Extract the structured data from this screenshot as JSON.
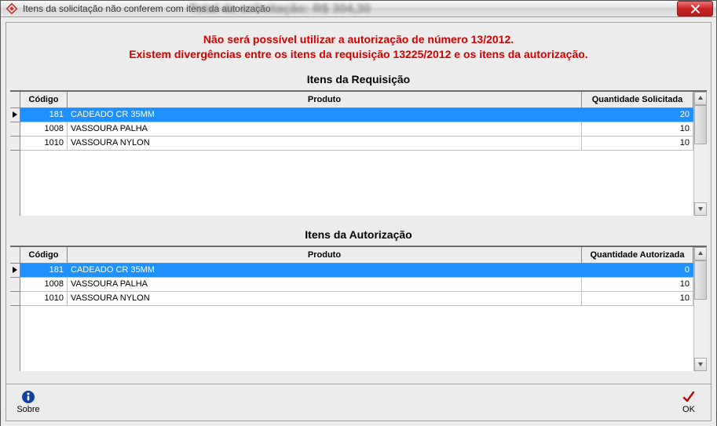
{
  "window": {
    "title": "Itens da solicitação não conferem com itens da autorização",
    "blurred_bg_text": "Total da solicitação: R$ 304,30"
  },
  "warning": {
    "line1": "Não será possível utilizar a autorização de número 13/2012.",
    "line2": "Existem divergências entre os itens da requisição 13225/2012 e os itens da autorização."
  },
  "section_req_title": "Itens da Requisição",
  "section_auth_title": "Itens da Autorização",
  "grid_req": {
    "headers": {
      "codigo": "Código",
      "produto": "Produto",
      "qtd": "Quantidade Solicitada"
    },
    "rows": [
      {
        "codigo": "181",
        "produto": "CADEADO CR 35MM",
        "qtd": "20",
        "selected": true
      },
      {
        "codigo": "1008",
        "produto": "VASSOURA PALHA",
        "qtd": "10",
        "selected": false
      },
      {
        "codigo": "1010",
        "produto": "VASSOURA NYLON",
        "qtd": "10",
        "selected": false
      }
    ]
  },
  "grid_auth": {
    "headers": {
      "codigo": "Código",
      "produto": "Produto",
      "qtd": "Quantidade Autorizada"
    },
    "rows": [
      {
        "codigo": "181",
        "produto": "CADEADO CR 35MM",
        "qtd": "0",
        "selected": true
      },
      {
        "codigo": "1008",
        "produto": "VASSOURA PALHA",
        "qtd": "10",
        "selected": false
      },
      {
        "codigo": "1010",
        "produto": "VASSOURA NYLON",
        "qtd": "10",
        "selected": false
      }
    ]
  },
  "buttons": {
    "sobre": "Sobre",
    "ok": "OK"
  }
}
